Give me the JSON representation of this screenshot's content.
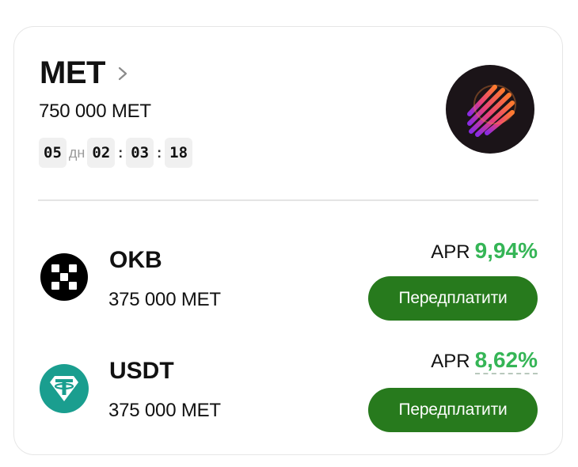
{
  "header": {
    "title": "MET",
    "amount": "750 000 MET"
  },
  "timer": {
    "days": "05",
    "days_unit": "дн",
    "hours": "02",
    "minutes": "03",
    "seconds": "18",
    "separator": ":"
  },
  "pools": [
    {
      "name": "OKB",
      "amount": "375 000 MET",
      "apr_label": "APR",
      "apr_value": "9,94%",
      "button_label": "Передплатити",
      "icon": "okb-icon"
    },
    {
      "name": "USDT",
      "amount": "375 000 MET",
      "apr_label": "APR",
      "apr_value": "8,62%",
      "button_label": "Передплатити",
      "icon": "usdt-icon"
    }
  ],
  "colors": {
    "accent_green": "#35b556",
    "button_green": "#277a1d",
    "usdt_teal": "#1a9e8f"
  }
}
